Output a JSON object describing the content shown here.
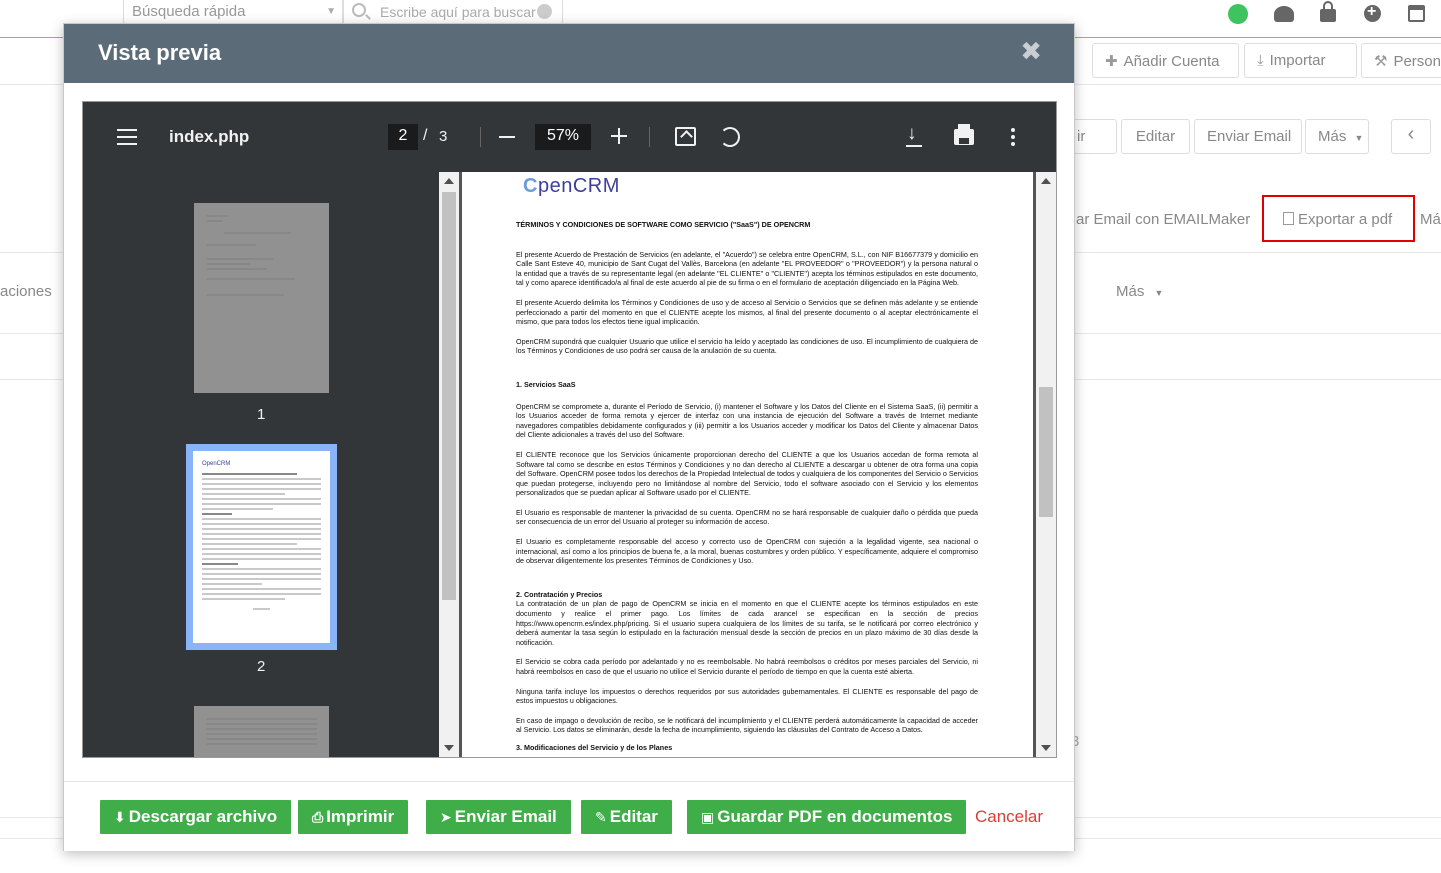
{
  "background": {
    "quick_search": "Búsqueda rápida",
    "search_placeholder": "Escribe aquí para buscar",
    "btn_add_account": "Añadir Cuenta",
    "btn_import": "Importar",
    "btn_person": "Person",
    "btn_partial": "ir",
    "btn_edit": "Editar",
    "btn_send_email": "Enviar Email",
    "btn_more": "Más",
    "btn_prev": "‹",
    "action_emailmaker": "ar Email con EMAILMaker",
    "action_export_pdf": "Exportar a pdf",
    "action_more_partial": "Má",
    "tab_partial": "aciones",
    "tab_more": "Más",
    "stray_digit": "3"
  },
  "modal": {
    "title": "Vista previa",
    "close": "✖"
  },
  "viewer": {
    "filename": "index.php",
    "current_page": "2",
    "page_separator": "/",
    "total_pages": "3",
    "zoom": "57%",
    "thumbnails": [
      "1",
      "2"
    ]
  },
  "document": {
    "logo_prefix": "C",
    "logo_text": "penCRM",
    "title": "TÉRMINOS Y CONDICIONES DE SOFTWARE COMO SERVICIO (\"SaaS\") DE OPENCRM",
    "p1": "El presente Acuerdo de Prestación de Servicios (en adelante, el \"Acuerdo\") se celebra entre OpenCRM, S.L., con NIF B16677379 y domicilio en Calle Sant Esteve 40, municipio de Sant Cugat del Vallès, Barcelona (en adelante \"EL PROVEEDOR\" o \"PROVEEDOR\") y la persona natural o la entidad que a través de su representante legal (en adelante \"EL CLIENTE\" o \"CLIENTE\") acepta los términos estipulados en este documento, tal y como aparece identificado/a al final de este acuerdo al pie de su firma o en el formulario de aceptación diligenciado en la Página Web.",
    "p2": "El presente Acuerdo delimita los Términos y Condiciones de uso y de acceso al Servicio o Servicios que se definen más adelante y se entiende perfeccionado a partir del momento en que el CLIENTE acepte los mismos, al final del presente documento o al aceptar electrónicamente el mismo, que para todos los efectos tiene igual implicación.",
    "p3": "OpenCRM supondrá que cualquier Usuario que utilice el servicio ha leído y aceptado las condiciones de uso. El incumplimiento de cualquiera de los Términos y Condiciones de uso podrá ser causa de la anulación de su cuenta.",
    "h1": "1. Servicios SaaS",
    "p4": "OpenCRM se compromete a, durante el Período de Servicio, (i) mantener el Software y los Datos del Cliente en el Sistema SaaS, (ii) permitir a los Usuarios acceder de forma remota y ejercer de interfaz con una instancia de ejecución del Software a través de Internet mediante navegadores compatibles debidamente configurados y (iii) permitir a los Usuarios acceder y modificar los Datos del Cliente y almacenar Datos del Cliente adicionales a través del uso del Software.",
    "p5": "El CLIENTE reconoce que los Servicios únicamente proporcionan derecho del CLIENTE a que los Usuarios accedan de forma remota al Software tal como se describe en estos Términos y Condiciones y no dan derecho al CLIENTE a descargar u obtener de otra forma una copia del Software. OpenCRM posee todos los derechos de la Propiedad Intelectual de todos y cualquiera de los componentes del Servicio o Servicios que puedan protegerse, incluyendo pero no limitándose al nombre del Servicio, todo el software asociado con el Servicio y los elementos personalizados que se puedan aplicar al Software usado por el CLIENTE.",
    "p6": "El Usuario es responsable de mantener la privacidad de su cuenta. OpenCRM no se hará responsable de cualquier daño o pérdida que pueda ser consecuencia de un error del Usuario al proteger su información de acceso.",
    "p7": "El Usuario es completamente responsable del acceso y correcto uso de OpenCRM con sujeción a la legalidad vigente, sea nacional o internacional, así como a los principios de buena fe, a la moral, buenas costumbres y orden público. Y específicamente, adquiere el compromiso de observar diligentemente los presentes Términos de Condiciones y Uso.",
    "h2": "2.  Contratación y Precios",
    "p8": "La contratación de un plan de pago de OpenCRM se inicia en el momento en que el CLIENTE acepte los términos estipulados en este documento y realice el primer pago. Los límites de cada arancel se especifican en la sección de precios https://www.opencrm.es/index.php/pricing. Si el usuario supera cualquiera de los límites de su tarifa, se le notificará por correo electrónico y deberá aumentar la tasa según lo estipulado en la facturación mensual desde la sección de precios en un plazo máximo de 30 días desde la notificación.",
    "p9": "El Servicio se cobra cada período por adelantado y no es reembolsable. No habrá reembolsos o créditos por meses parciales del Servicio, ni habrá reembolsos en caso de que el usuario no utilice el Servicio durante el período de tiempo en que la cuenta esté abierta.",
    "p10": "Ninguna tarifa incluye los impuestos o derechos requeridos por sus autoridades gubernamentales. El CLIENTE es responsable del pago de estos impuestos u obligaciones.",
    "p11": "En caso de impago o devolución de recibo, se le notificará del incumplimiento y el CLIENTE perderá automáticamente la capacidad de acceder al Servicio. Los datos se eliminarán, desde la fecha de incumplimiento, siguiendo las cláusulas del Contrato de Acceso a Datos.",
    "h3": "3. Modificaciones del Servicio y de los Planes"
  },
  "footer": {
    "download": "Descargar archivo",
    "print": "Imprimir",
    "send_email": "Enviar Email",
    "edit": "Editar",
    "save_pdf": "Guardar PDF en documentos",
    "cancel": "Cancelar"
  },
  "colors": {
    "modal_header": "#5c6b78",
    "green_button": "#3fae49",
    "cancel": "#e03b3b",
    "highlight_frame": "#e00000"
  }
}
